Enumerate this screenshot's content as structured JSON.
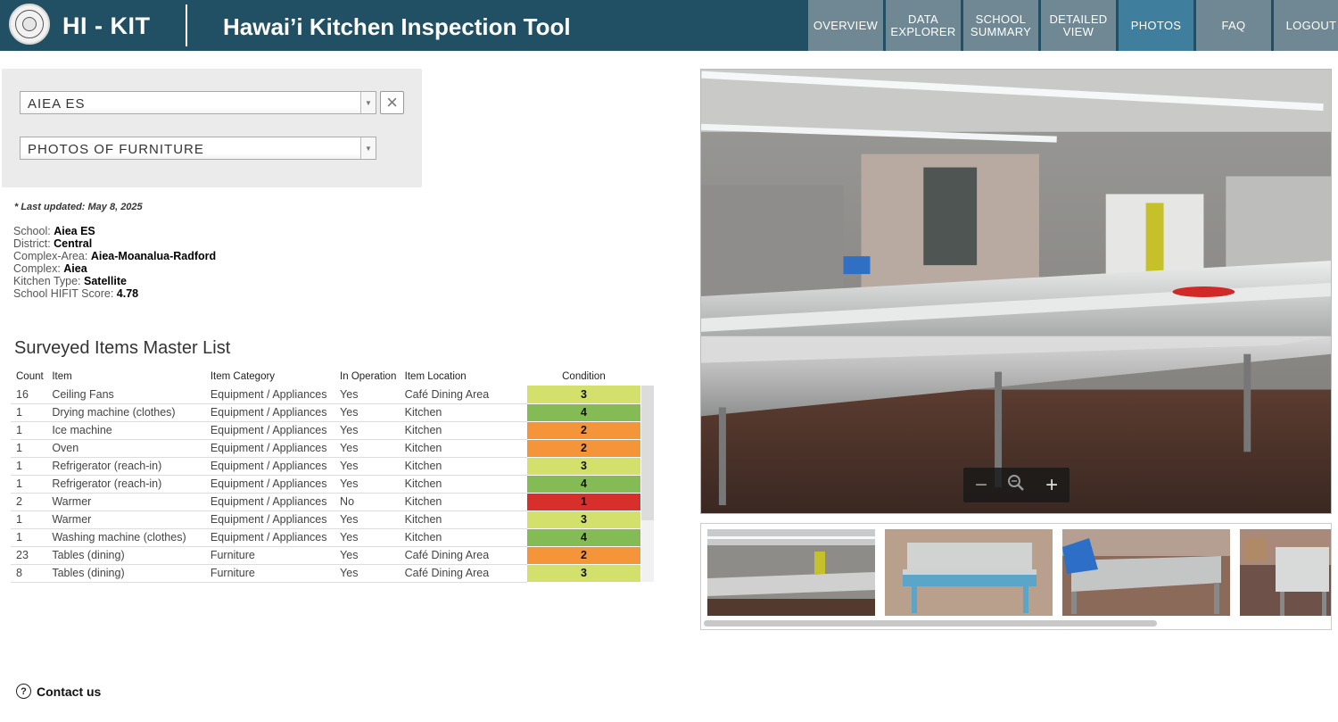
{
  "header": {
    "brand": "HI - KIT",
    "title": "Hawai’i Kitchen Inspection Tool",
    "nav": [
      {
        "label": "OVERVIEW"
      },
      {
        "label": "DATA EXPLORER"
      },
      {
        "label": "SCHOOL SUMMARY"
      },
      {
        "label": "DETAILED VIEW"
      },
      {
        "label": "PHOTOS",
        "active": true
      },
      {
        "label": "FAQ"
      },
      {
        "label": "LOGOUT"
      }
    ]
  },
  "filters": {
    "school_select": "AIEA ES",
    "photo_select": "PHOTOS OF FURNITURE",
    "clear_icon": "close-icon"
  },
  "last_updated": "* Last updated: May 8, 2025",
  "school": {
    "school_label": "School:",
    "school_value": "Aiea ES",
    "district_label": "District:",
    "district_value": "Central",
    "complex_area_label": "Complex-Area:",
    "complex_area_value": "Aiea-Moanalua-Radford",
    "complex_label": "Complex:",
    "complex_value": "Aiea",
    "kitchen_type_label": "Kitchen Type:",
    "kitchen_type_value": "Satellite",
    "score_label": "School HIFIT Score:",
    "score_value": "4.78"
  },
  "master_list": {
    "title": "Surveyed Items Master List",
    "columns": [
      "Count",
      "Item",
      "Item Category",
      "In Operation",
      "Item Location",
      "Condition"
    ],
    "rows": [
      {
        "count": "16",
        "item": "Ceiling Fans",
        "category": "Equipment / Appliances",
        "in_operation": "Yes",
        "location": "Café Dining Area",
        "condition": "3"
      },
      {
        "count": "1",
        "item": "Drying machine (clothes)",
        "category": "Equipment / Appliances",
        "in_operation": "Yes",
        "location": "Kitchen",
        "condition": "4"
      },
      {
        "count": "1",
        "item": "Ice machine",
        "category": "Equipment / Appliances",
        "in_operation": "Yes",
        "location": "Kitchen",
        "condition": "2"
      },
      {
        "count": "1",
        "item": "Oven",
        "category": "Equipment / Appliances",
        "in_operation": "Yes",
        "location": "Kitchen",
        "condition": "2"
      },
      {
        "count": "1",
        "item": "Refrigerator (reach-in)",
        "category": "Equipment / Appliances",
        "in_operation": "Yes",
        "location": "Kitchen",
        "condition": "3"
      },
      {
        "count": "1",
        "item": "Refrigerator (reach-in)",
        "category": "Equipment / Appliances",
        "in_operation": "Yes",
        "location": "Kitchen",
        "condition": "4"
      },
      {
        "count": "2",
        "item": "Warmer",
        "category": "Equipment / Appliances",
        "in_operation": "No",
        "location": "Kitchen",
        "condition": "1"
      },
      {
        "count": "1",
        "item": "Warmer",
        "category": "Equipment / Appliances",
        "in_operation": "Yes",
        "location": "Kitchen",
        "condition": "3"
      },
      {
        "count": "1",
        "item": "Washing machine (clothes)",
        "category": "Equipment / Appliances",
        "in_operation": "Yes",
        "location": "Kitchen",
        "condition": "4"
      },
      {
        "count": "23",
        "item": "Tables (dining)",
        "category": "Furniture",
        "in_operation": "Yes",
        "location": "Café Dining Area",
        "condition": "2"
      },
      {
        "count": "8",
        "item": "Tables (dining)",
        "category": "Furniture",
        "in_operation": "Yes",
        "location": "Café Dining Area",
        "condition": "3"
      }
    ]
  },
  "condition_colors": {
    "1": "#d7302a",
    "2": "#f5953a",
    "3": "#d3e06c",
    "4": "#84bb55"
  },
  "viewer": {
    "zoom_out_icon": "minus-icon",
    "zoom_reset_icon": "magnifier-icon",
    "zoom_in_icon": "plus-icon",
    "thumbnail_count": 4
  },
  "contact": {
    "label": "Contact us",
    "icon": "question-icon"
  }
}
